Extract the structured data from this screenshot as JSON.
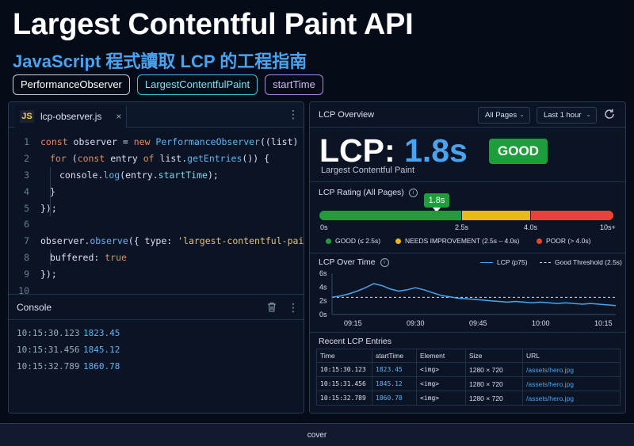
{
  "header": {
    "title": "Largest Contentful Paint API",
    "subtitle": "JavaScript 程式讀取 LCP 的工程指南",
    "tags": [
      "PerformanceObserver",
      "LargestContentfulPaint",
      "startTime"
    ]
  },
  "editor": {
    "tab_icon": "JS",
    "filename": "lcp-observer.js",
    "close": "×",
    "line_numbers": [
      "1",
      "2",
      "3",
      "4",
      "5",
      "6",
      "7",
      "8",
      "9",
      "10"
    ],
    "code": {
      "l1": {
        "a": "const ",
        "b": "observer",
        "c": " = ",
        "d": "new ",
        "e": "PerformanceObserver",
        "f": "((list) => {"
      },
      "l2": {
        "a": "for ",
        "b": "(",
        "c": "const ",
        "d": "entry ",
        "e": "of ",
        "f": "list.",
        "g": "getEntries",
        "h": "()) {"
      },
      "l3": {
        "a": "console.",
        "b": "log",
        "c": "(entry.",
        "d": "startTime",
        "e": ");"
      },
      "l4": "}",
      "l5": "});",
      "l7": {
        "a": "observer.",
        "b": "observe",
        "c": "({ type: ",
        "d": "'largest-contentful-paint'",
        "e": ","
      },
      "l8": {
        "a": "buffered: ",
        "b": "true"
      },
      "l9": "});"
    }
  },
  "console": {
    "title": "Console",
    "logs": [
      {
        "time": "10:15:30.123",
        "value": "1823.45"
      },
      {
        "time": "10:15:31.456",
        "value": "1845.12"
      },
      {
        "time": "10:15:32.789",
        "value": "1860.78"
      }
    ]
  },
  "overview": {
    "title": "LCP Overview",
    "filter_pages": "All Pages",
    "filter_time": "Last 1 hour",
    "lcp_label": "LCP:",
    "lcp_value": "1.8s",
    "badge": "GOOD",
    "lcp_sub": "Largest Contentful Paint",
    "rating_title": "LCP Rating (All Pages)",
    "marker": "1.8s",
    "marker_value": 1.8,
    "rating_ticks": [
      "0s",
      "2.5s",
      "4.0s",
      "10s+"
    ],
    "legend": [
      "GOOD (≤ 2.5s)",
      "NEEDS IMPROVEMENT (2.5s – 4.0s)",
      "POOR (> 4.0s)"
    ],
    "colors": {
      "good": "#1e9e3b",
      "needs": "#f2b31b",
      "poor": "#e8452f",
      "accent": "#4aa3f0"
    },
    "chart_title": "LCP Over Time",
    "chart_legend": [
      "LCP (p75)",
      "Good Threshold (2.5s)"
    ],
    "recent_title": "Recent LCP Entries",
    "table": {
      "headers": [
        "Time",
        "startTime",
        "Element",
        "Size",
        "URL"
      ],
      "rows": [
        [
          "10:15:30.123",
          "1823.45",
          "<img>",
          "1280 × 720",
          "/assets/hero.jpg"
        ],
        [
          "10:15:31.456",
          "1845.12",
          "<img>",
          "1280 × 720",
          "/assets/hero.jpg"
        ],
        [
          "10:15:32.789",
          "1860.78",
          "<img>",
          "1280 × 720",
          "/assets/hero.jpg"
        ]
      ]
    }
  },
  "chart_data": {
    "type": "line",
    "title": "LCP Over Time",
    "xlabel": "",
    "ylabel": "",
    "x_ticks": [
      "09:15",
      "09:30",
      "09:45",
      "10:00",
      "10:15"
    ],
    "y_ticks": [
      "0s",
      "2s",
      "4s",
      "6s"
    ],
    "ylim": [
      0,
      6
    ],
    "x_range_minutes": [
      9.0,
      10.333
    ],
    "series": [
      {
        "name": "LCP (p75)",
        "x": [
          "09:10",
          "09:12",
          "09:14",
          "09:16",
          "09:18",
          "09:20",
          "09:22",
          "09:24",
          "09:26",
          "09:28",
          "09:30",
          "09:32",
          "09:34",
          "09:36",
          "09:38",
          "09:40",
          "09:42",
          "09:44",
          "09:46",
          "09:48",
          "09:50",
          "09:52",
          "09:54",
          "09:56",
          "09:58",
          "10:00",
          "10:02",
          "10:04",
          "10:06",
          "10:08",
          "10:10",
          "10:12",
          "10:14",
          "10:16",
          "10:18"
        ],
        "values": [
          2.5,
          2.7,
          3.0,
          3.4,
          3.9,
          4.5,
          4.2,
          3.7,
          3.4,
          3.6,
          3.9,
          3.6,
          3.2,
          2.8,
          2.6,
          2.4,
          2.3,
          2.2,
          2.1,
          2.0,
          1.9,
          1.8,
          1.9,
          1.8,
          1.7,
          1.8,
          1.7,
          1.6,
          1.7,
          1.6,
          1.5,
          1.6,
          1.5,
          1.4,
          1.3
        ]
      },
      {
        "name": "Good Threshold (2.5s)",
        "values": [
          2.5
        ]
      }
    ],
    "legend_position": "top-right",
    "grid": false
  },
  "footer": "cover"
}
